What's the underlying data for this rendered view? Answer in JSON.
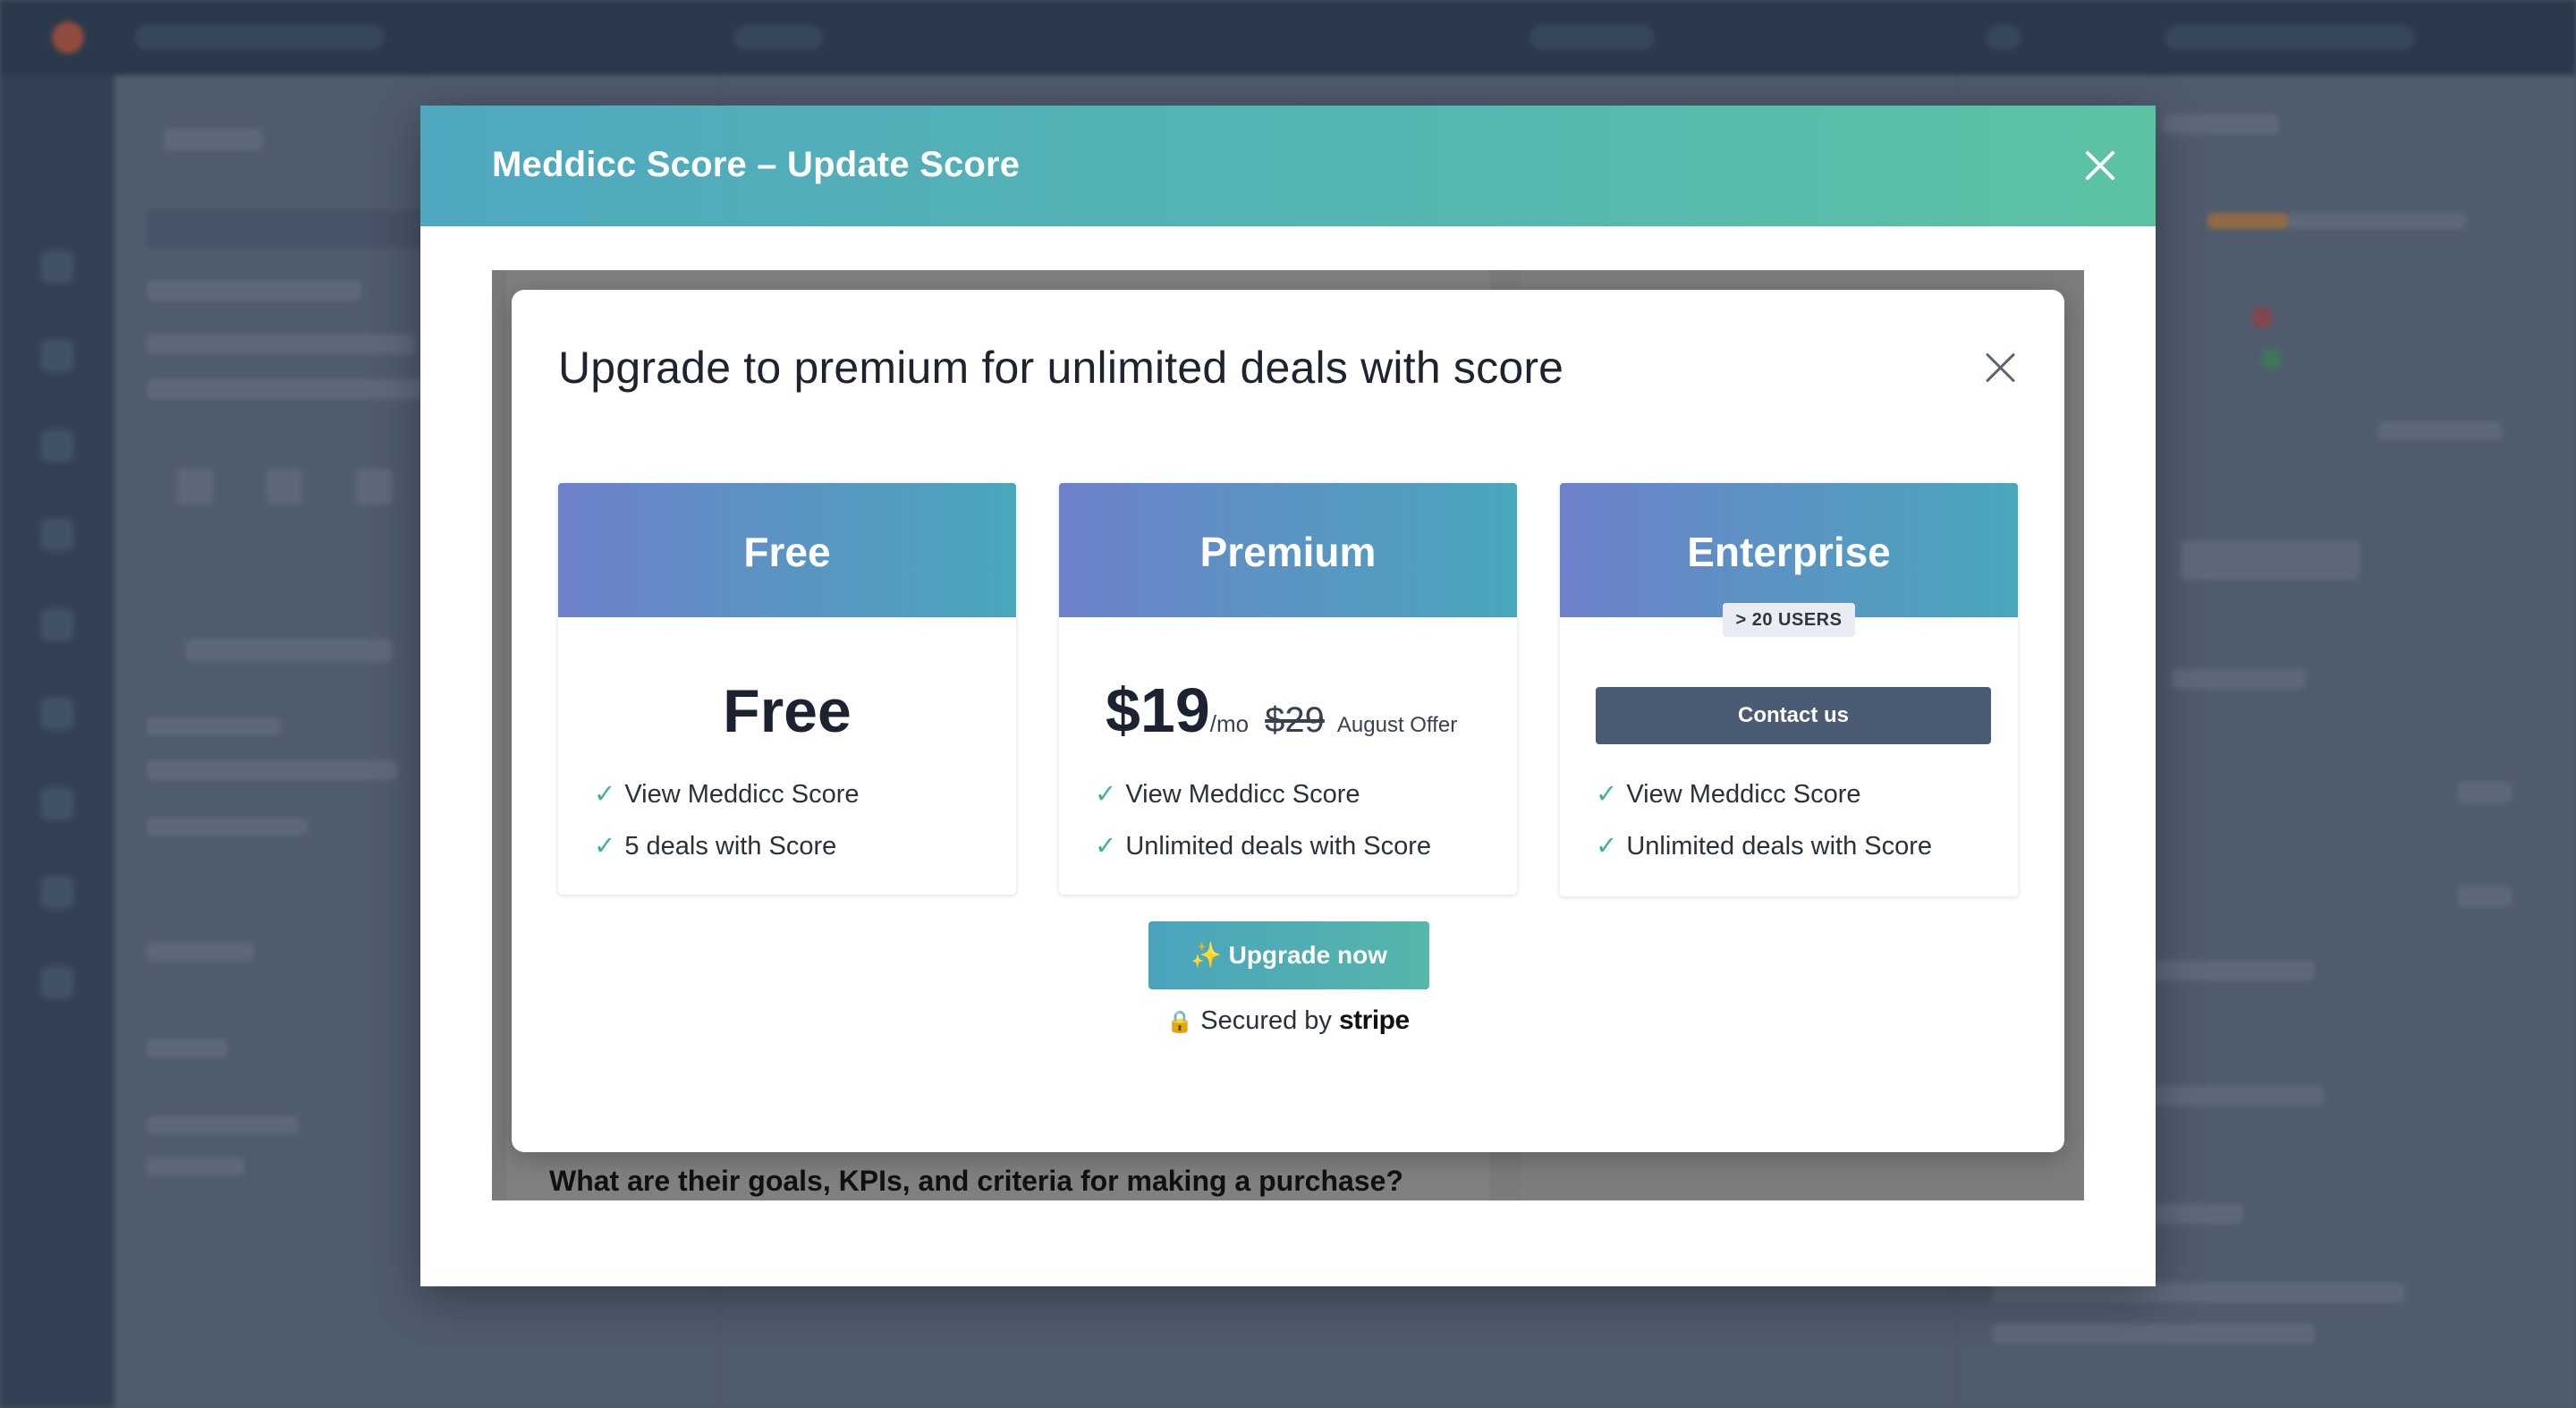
{
  "outer_modal": {
    "title": "Meddicc Score – Update Score"
  },
  "background": {
    "question": "What are their goals, KPIs, and criteria for making a purchase?"
  },
  "upgrade_dialog": {
    "title": "Upgrade to premium for unlimited deals with score",
    "plans": [
      {
        "name": "Free",
        "price": "Free",
        "features": [
          "View Meddicc Score",
          "5 deals with Score"
        ]
      },
      {
        "name": "Premium",
        "price": "$19",
        "price_unit": "/mo",
        "old_price": "$29",
        "offer": "August Offer",
        "features": [
          "View Meddicc Score",
          "Unlimited deals with Score"
        ]
      },
      {
        "name": "Enterprise",
        "badge": "> 20 USERS",
        "cta": "Contact us",
        "features": [
          "View Meddicc Score",
          "Unlimited deals with Score"
        ]
      }
    ],
    "check_mark": "✓",
    "upgrade_button": "✨ Upgrade now",
    "secured_text": "Secured by",
    "secured_brand": "stripe",
    "lock_icon": "🔒"
  },
  "colors": {
    "header_gradient_start": "#4fa8bf",
    "header_gradient_end": "#5cc2a4",
    "plan_header_start": "#6d80cb",
    "plan_header_end": "#49a7bb",
    "contact_button": "#4a5b73",
    "check": "#3bb394"
  }
}
